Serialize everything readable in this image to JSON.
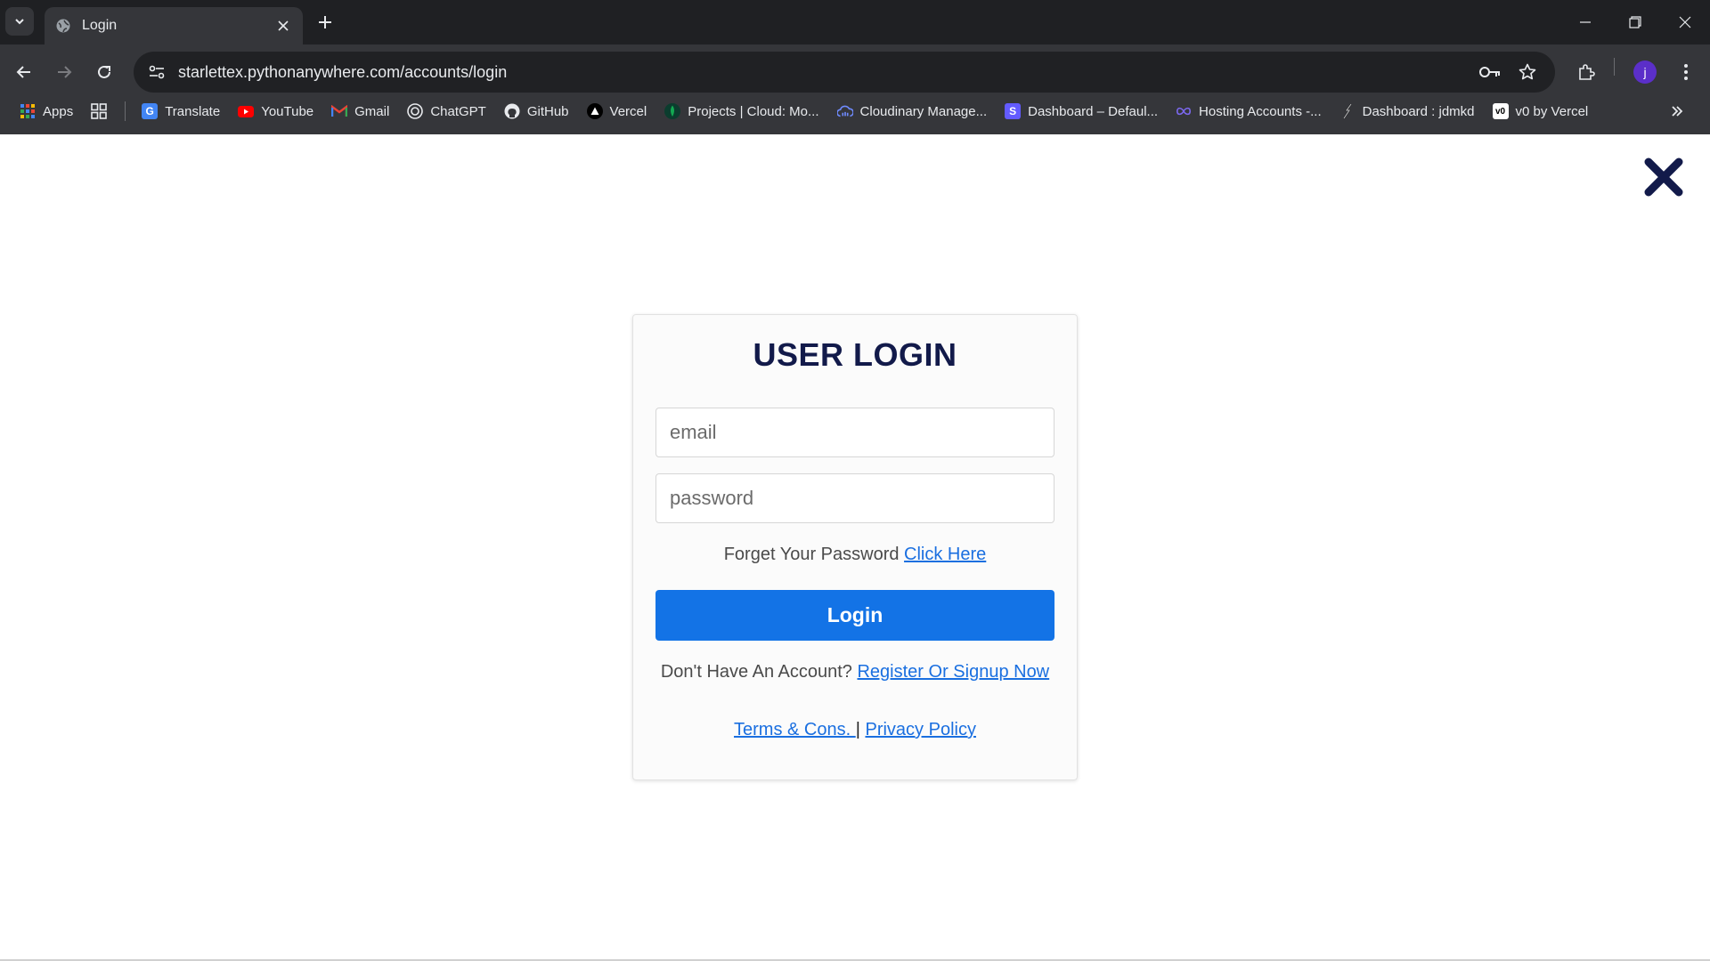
{
  "browser": {
    "tab": {
      "title": "Login"
    },
    "url": "starlettex.pythonanywhere.com/accounts/login",
    "profile_initial": "j",
    "bookmarks": [
      {
        "label": "Apps",
        "icon": "apps-grid-icon"
      },
      {
        "label": "Translate",
        "icon": "google-translate-icon"
      },
      {
        "label": "YouTube",
        "icon": "youtube-icon"
      },
      {
        "label": "Gmail",
        "icon": "gmail-icon"
      },
      {
        "label": "ChatGPT",
        "icon": "chatgpt-icon"
      },
      {
        "label": "GitHub",
        "icon": "github-icon"
      },
      {
        "label": "Vercel",
        "icon": "vercel-icon"
      },
      {
        "label": "Projects | Cloud: Mo...",
        "icon": "mongodb-icon"
      },
      {
        "label": "Cloudinary Manage...",
        "icon": "cloudinary-icon"
      },
      {
        "label": "Dashboard – Defaul...",
        "icon": "stripe-icon"
      },
      {
        "label": "Hosting Accounts -...",
        "icon": "infinity-icon"
      },
      {
        "label": "Dashboard : jdmkd",
        "icon": "pythonanywhere-icon"
      },
      {
        "label": "v0 by Vercel",
        "icon": "v0-icon"
      }
    ],
    "colors": {
      "chrome_dark": "#1f2023",
      "toolbar": "#35363a",
      "omnibox": "#202124"
    }
  },
  "login": {
    "title": "USER LOGIN",
    "email_placeholder": "email",
    "password_placeholder": "password",
    "forgot_text": "Forget Your Password ",
    "forgot_link": "Click Here",
    "submit_label": "Login",
    "signup_text": "Don't Have An Account? ",
    "signup_link": "Register Or Signup Now",
    "terms_link": "Terms & Cons. ",
    "separator": "|",
    "privacy_link": "Privacy Policy"
  },
  "colors": {
    "primary": "#1373e6",
    "title": "#121a4a",
    "link": "#1a6fe0",
    "close": "#121a4a"
  }
}
